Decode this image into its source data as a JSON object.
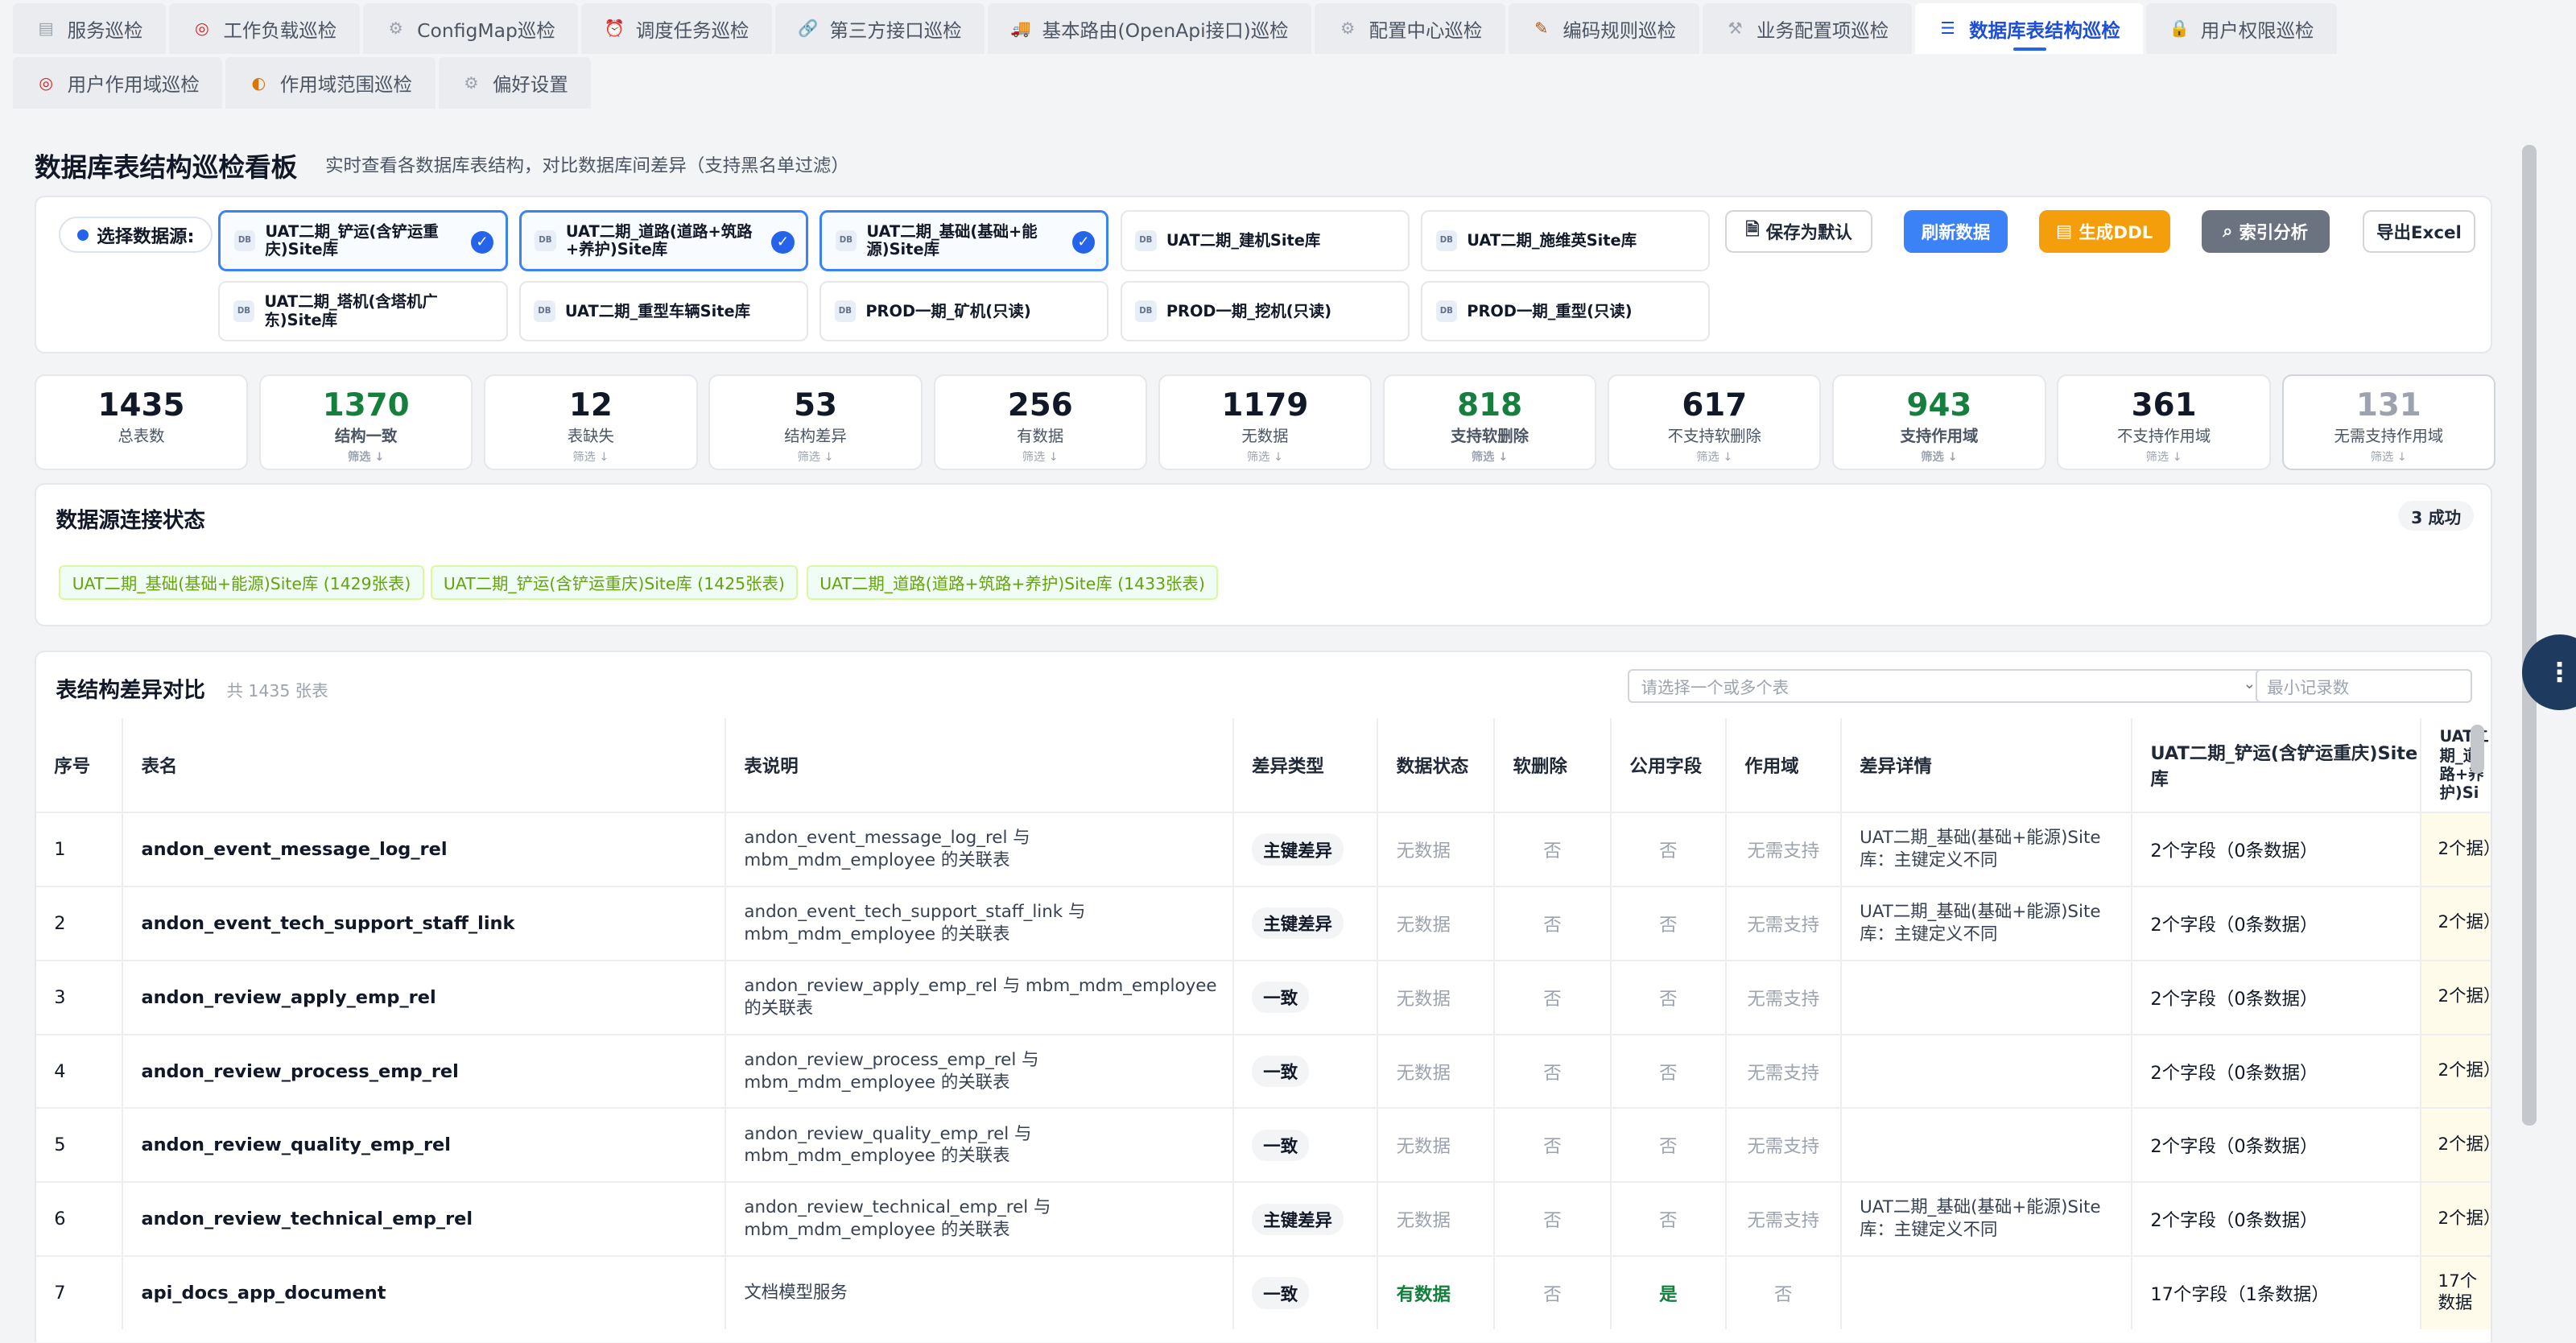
{
  "tabs": [
    {
      "label": "服务巡检",
      "icon": "doc-icon",
      "glyph": "▤",
      "color": "#9ca3af",
      "active": false
    },
    {
      "label": "工作负载巡检",
      "icon": "target-icon",
      "glyph": "◎",
      "color": "#dc2626",
      "active": false
    },
    {
      "label": "ConfigMap巡检",
      "icon": "gear-icon",
      "glyph": "⚙",
      "color": "#9ca3af",
      "active": false
    },
    {
      "label": "调度任务巡检",
      "icon": "alarm-clock-icon",
      "glyph": "⏰",
      "color": "#dc2626",
      "active": false
    },
    {
      "label": "第三方接口巡检",
      "icon": "link-icon",
      "glyph": "🔗",
      "color": "#9ca3af",
      "active": false
    },
    {
      "label": "基本路由(OpenApi接口)巡检",
      "icon": "truck-icon",
      "glyph": "🚚",
      "color": "#6b7280",
      "active": false
    },
    {
      "label": "配置中心巡检",
      "icon": "gear-icon",
      "glyph": "⚙",
      "color": "#9ca3af",
      "active": false
    },
    {
      "label": "编码规则巡检",
      "icon": "memo-icon",
      "glyph": "✎",
      "color": "#b45309",
      "active": false
    },
    {
      "label": "业务配置项巡检",
      "icon": "wrench-icon",
      "glyph": "⚒",
      "color": "#9ca3af",
      "active": false
    },
    {
      "label": "数据库表结构巡检",
      "icon": "database-icon",
      "glyph": "☰",
      "color": "#1d4ed8",
      "active": true
    },
    {
      "label": "用户权限巡检",
      "icon": "lock-icon",
      "glyph": "🔒",
      "color": "#d97706",
      "active": false
    },
    {
      "label": "用户作用域巡检",
      "icon": "target-icon",
      "glyph": "◎",
      "color": "#dc2626",
      "active": false
    },
    {
      "label": "作用域范围巡检",
      "icon": "palette-icon",
      "glyph": "◐",
      "color": "#d97706",
      "active": false
    },
    {
      "label": "偏好设置",
      "icon": "gear-icon",
      "glyph": "⚙",
      "color": "#9ca3af",
      "active": false
    }
  ],
  "header": {
    "title": "数据库表结构巡检看板",
    "subtitle": "实时查看各数据库表结构，对比数据库间差异（支持黑名单过滤）"
  },
  "datasource": {
    "label": "选择数据源:",
    "db_icon_text": "DB",
    "sources": [
      {
        "name": "UAT二期_铲运(含铲运重庆)Site库",
        "selected": true
      },
      {
        "name": "UAT二期_道路(道路+筑路+养护)Site库",
        "selected": true
      },
      {
        "name": "UAT二期_基础(基础+能源)Site库",
        "selected": true
      },
      {
        "name": "UAT二期_建机Site库",
        "selected": false
      },
      {
        "name": "UAT二期_施维英Site库",
        "selected": false
      },
      {
        "name": "UAT二期_塔机(含塔机广东)Site库",
        "selected": false
      },
      {
        "name": "UAT二期_重型车辆Site库",
        "selected": false
      },
      {
        "name": "PROD一期_矿机(只读)",
        "selected": false
      },
      {
        "name": "PROD一期_挖机(只读)",
        "selected": false
      },
      {
        "name": "PROD一期_重型(只读)",
        "selected": false
      }
    ],
    "save_default": "保存为默认",
    "refresh": "刷新数据",
    "gen_ddl": "生成DDL",
    "index_analysis": "索引分析",
    "export": "导出Excel",
    "colors": {
      "refresh": "#3b82f6",
      "ddl": "#f59e0b",
      "index": "#6b7280"
    }
  },
  "stats": [
    {
      "value": "1435",
      "label": "总表数",
      "filter": "",
      "style": "normal"
    },
    {
      "value": "1370",
      "label": "结构一致",
      "filter": "筛选 ↓",
      "style": "green"
    },
    {
      "value": "12",
      "label": "表缺失",
      "filter": "筛选 ↓",
      "style": "normal"
    },
    {
      "value": "53",
      "label": "结构差异",
      "filter": "筛选 ↓",
      "style": "normal"
    },
    {
      "value": "256",
      "label": "有数据",
      "filter": "筛选 ↓",
      "style": "normal"
    },
    {
      "value": "1179",
      "label": "无数据",
      "filter": "筛选 ↓",
      "style": "normal"
    },
    {
      "value": "818",
      "label": "支持软删除",
      "filter": "筛选 ↓",
      "style": "green"
    },
    {
      "value": "617",
      "label": "不支持软删除",
      "filter": "筛选 ↓",
      "style": "normal"
    },
    {
      "value": "943",
      "label": "支持作用域",
      "filter": "筛选 ↓",
      "style": "green"
    },
    {
      "value": "361",
      "label": "不支持作用域",
      "filter": "筛选 ↓",
      "style": "normal"
    },
    {
      "value": "131",
      "label": "无需支持作用域",
      "filter": "筛选 ↓",
      "style": "grey"
    }
  ],
  "connection": {
    "title": "数据源连接状态",
    "badge": "3 成功",
    "tags": [
      "UAT二期_基础(基础+能源)Site库 (1429张表)",
      "UAT二期_铲运(含铲运重庆)Site库 (1425张表)",
      "UAT二期_道路(道路+筑路+养护)Site库 (1433张表)"
    ]
  },
  "table": {
    "title": "表结构差异对比",
    "count": "共 1435 张表",
    "select_placeholder": "请选择一个或多个表",
    "min_placeholder": "最小记录数",
    "columns": [
      "序号",
      "表名",
      "表说明",
      "差异类型",
      "数据状态",
      "软删除",
      "公用字段",
      "作用域",
      "差异详情",
      "UAT二期_铲运(含铲运重庆)Site库",
      "UAT二期_道路+养护)Si"
    ],
    "rows": [
      {
        "no": "1",
        "name": "andon_event_message_log_rel",
        "desc": "andon_event_message_log_rel 与 mbm_mdm_employee 的关联表",
        "diff": "主键差异",
        "data": "无数据",
        "soft": "否",
        "common": "否",
        "scope": "无需支持",
        "detail": "UAT二期_基础(基础+能源)Site库：主键定义不同",
        "c1": "2个字段（0条数据）",
        "c2": "2个据）"
      },
      {
        "no": "2",
        "name": "andon_event_tech_support_staff_link",
        "desc": "andon_event_tech_support_staff_link 与 mbm_mdm_employee 的关联表",
        "diff": "主键差异",
        "data": "无数据",
        "soft": "否",
        "common": "否",
        "scope": "无需支持",
        "detail": "UAT二期_基础(基础+能源)Site库：主键定义不同",
        "c1": "2个字段（0条数据）",
        "c2": "2个据）"
      },
      {
        "no": "3",
        "name": "andon_review_apply_emp_rel",
        "desc": "andon_review_apply_emp_rel 与 mbm_mdm_employee 的关联表",
        "diff": "一致",
        "data": "无数据",
        "soft": "否",
        "common": "否",
        "scope": "无需支持",
        "detail": "",
        "c1": "2个字段（0条数据）",
        "c2": "2个据）"
      },
      {
        "no": "4",
        "name": "andon_review_process_emp_rel",
        "desc": "andon_review_process_emp_rel 与 mbm_mdm_employee 的关联表",
        "diff": "一致",
        "data": "无数据",
        "soft": "否",
        "common": "否",
        "scope": "无需支持",
        "detail": "",
        "c1": "2个字段（0条数据）",
        "c2": "2个据）"
      },
      {
        "no": "5",
        "name": "andon_review_quality_emp_rel",
        "desc": "andon_review_quality_emp_rel 与 mbm_mdm_employee 的关联表",
        "diff": "一致",
        "data": "无数据",
        "soft": "否",
        "common": "否",
        "scope": "无需支持",
        "detail": "",
        "c1": "2个字段（0条数据）",
        "c2": "2个据）"
      },
      {
        "no": "6",
        "name": "andon_review_technical_emp_rel",
        "desc": "andon_review_technical_emp_rel 与 mbm_mdm_employee 的关联表",
        "diff": "主键差异",
        "data": "无数据",
        "soft": "否",
        "common": "否",
        "scope": "无需支持",
        "detail": "UAT二期_基础(基础+能源)Site库：主键定义不同",
        "c1": "2个字段（0条数据）",
        "c2": "2个据）"
      },
      {
        "no": "7",
        "name": "api_docs_app_document",
        "desc": "文档模型服务",
        "diff": "一致",
        "data": "有数据",
        "soft": "否",
        "common": "是",
        "scope": "否",
        "detail": "",
        "c1": "17个字段（1条数据）",
        "c2": "17个数据"
      }
    ]
  },
  "float_button_glyph": "⋮"
}
